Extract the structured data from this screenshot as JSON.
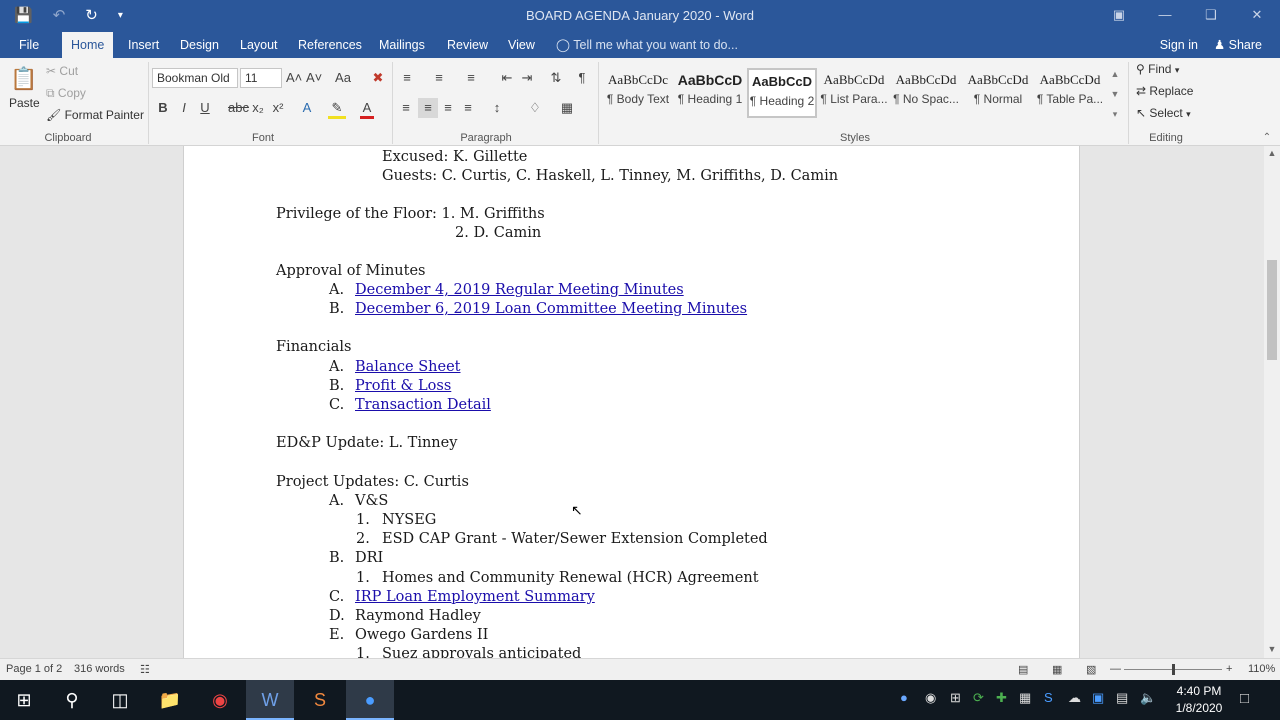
{
  "window": {
    "title": "BOARD AGENDA January 2020 - Word"
  },
  "tabs": [
    {
      "label": "File"
    },
    {
      "label": "Home"
    },
    {
      "label": "Insert"
    },
    {
      "label": "Design"
    },
    {
      "label": "Layout"
    },
    {
      "label": "References"
    },
    {
      "label": "Mailings"
    },
    {
      "label": "Review"
    },
    {
      "label": "View"
    }
  ],
  "tell_me": "Tell me what you want to do...",
  "account": {
    "sign_in": "Sign in",
    "share": "Share"
  },
  "clipboard": {
    "paste": "Paste",
    "cut": "Cut",
    "copy": "Copy",
    "format_painter": "Format Painter",
    "label": "Clipboard"
  },
  "font": {
    "name": "Bookman Old",
    "size": "11",
    "label": "Font"
  },
  "paragraph": {
    "label": "Paragraph"
  },
  "styles": {
    "label": "Styles",
    "items": [
      {
        "preview": "AaBbCcDc",
        "name": "¶ Body Text"
      },
      {
        "preview": "AaBbCcD",
        "name": "¶ Heading 1"
      },
      {
        "preview": "AaBbCcD",
        "name": "¶ Heading 2"
      },
      {
        "preview": "AaBbCcDd",
        "name": "¶ List Para..."
      },
      {
        "preview": "AaBbCcDd",
        "name": "¶ No Spac..."
      },
      {
        "preview": "AaBbCcDd",
        "name": "¶ Normal"
      },
      {
        "preview": "AaBbCcDd",
        "name": "¶ Table Pa..."
      }
    ]
  },
  "editing": {
    "find": "Find",
    "replace": "Replace",
    "select": "Select",
    "label": "Editing"
  },
  "document": {
    "excused": "Excused:  K. Gillette",
    "guests": "Guests:  C. Curtis, C. Haskell, L. Tinney, M. Griffiths, D. Camin",
    "privilege": "Privilege of the Floor:  1. M. Griffiths",
    "privilege_2": "2. D. Camin",
    "approval_heading": "Approval of Minutes",
    "approval_items": [
      {
        "marker": "A.",
        "text": "December 4, 2019 Regular Meeting Minutes"
      },
      {
        "marker": "B.",
        "text": "December 6, 2019 Loan Committee Meeting Minutes"
      }
    ],
    "financials_heading": "Financials",
    "financial_items": [
      {
        "marker": "A.",
        "text": "Balance Sheet"
      },
      {
        "marker": "B.",
        "text": "Profit & Loss"
      },
      {
        "marker": "C.",
        "text": "Transaction Detail"
      }
    ],
    "edp": "ED&P Update:  L. Tinney",
    "project_heading": "Project Updates:  C. Curtis",
    "project_a": {
      "marker": "A.",
      "text": "V&S"
    },
    "project_a_sub": [
      {
        "marker": "1.",
        "text": "NYSEG"
      },
      {
        "marker": "2.",
        "text": "ESD CAP Grant - Water/Sewer Extension Completed"
      }
    ],
    "project_b": {
      "marker": "B.",
      "text": "DRI"
    },
    "project_b_sub": [
      {
        "marker": "1.",
        "text": "Homes and Community Renewal (HCR) Agreement"
      }
    ],
    "project_c": {
      "marker": "C.",
      "text": "IRP Loan Employment Summary"
    },
    "project_d": {
      "marker": "D.",
      "text": "Raymond Hadley"
    },
    "project_e": {
      "marker": "E.",
      "text": "Owego Gardens II"
    },
    "project_e_sub": [
      {
        "marker": "1.",
        "text": "Suez approvals anticipated"
      }
    ]
  },
  "status": {
    "page": "Page 1 of 2",
    "words": "316 words",
    "zoom": "110%"
  },
  "clock": {
    "time": "4:40 PM",
    "date": "1/8/2020"
  }
}
